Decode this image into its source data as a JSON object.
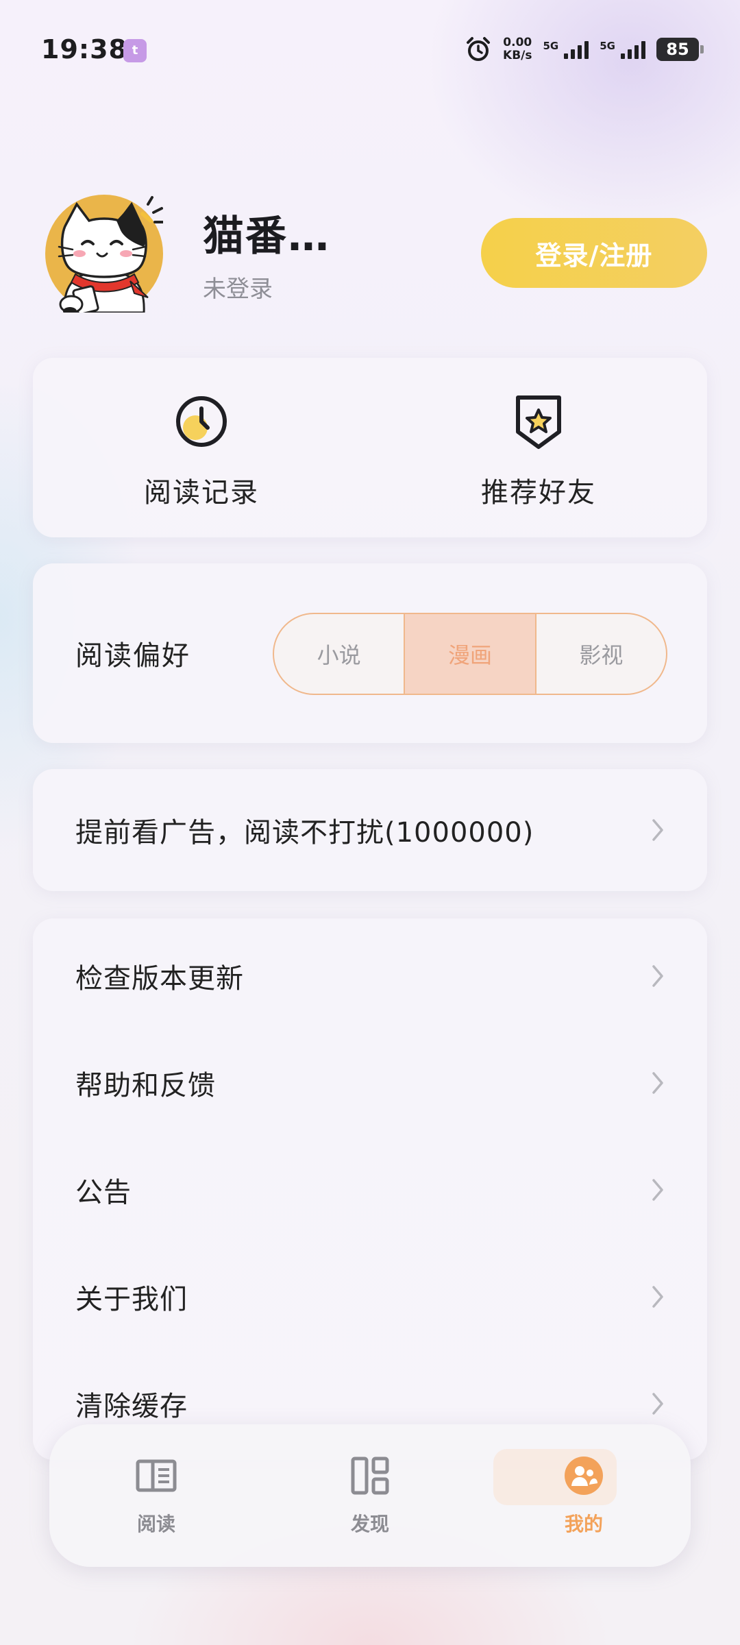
{
  "status_bar": {
    "time": "19:38",
    "app_badge": "t",
    "net_speed_value": "0.00",
    "net_speed_unit": "KB/s",
    "sim1_label": "5G",
    "sim2_label": "5G",
    "battery": "85"
  },
  "profile": {
    "name": "猫番…",
    "status": "未登录",
    "login_button": "登录/注册"
  },
  "quick_actions": [
    {
      "label": "阅读记录",
      "icon": "clock-icon"
    },
    {
      "label": "推荐好友",
      "icon": "star-badge-icon"
    }
  ],
  "preference": {
    "label": "阅读偏好",
    "options": [
      "小说",
      "漫画",
      "影视"
    ],
    "selected": "漫画"
  },
  "ad_row": {
    "label": "提前看广告，阅读不打扰(1000000)"
  },
  "settings": [
    {
      "label": "检查版本更新"
    },
    {
      "label": "帮助和反馈"
    },
    {
      "label": "公告"
    },
    {
      "label": "关于我们"
    },
    {
      "label": "清除缓存"
    }
  ],
  "bottom_nav": {
    "items": [
      {
        "label": "阅读",
        "icon": "book-icon"
      },
      {
        "label": "发现",
        "icon": "discover-icon"
      },
      {
        "label": "我的",
        "icon": "profile-icon"
      }
    ],
    "active": "我的"
  },
  "colors": {
    "accent_yellow": "#f5d04a",
    "accent_orange": "#f3a25a",
    "pref_border": "#f0b88c"
  }
}
